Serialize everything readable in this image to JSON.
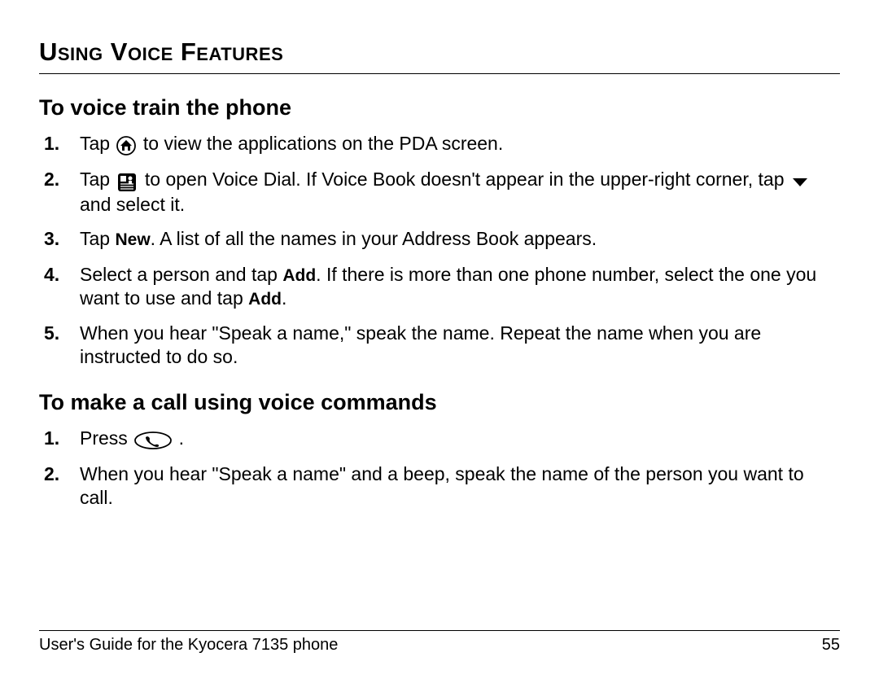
{
  "page_title": "Using Voice Features",
  "sections": [
    {
      "heading": "To voice train the phone",
      "steps": [
        {
          "parts": [
            {
              "type": "text",
              "value": "Tap "
            },
            {
              "type": "icon",
              "name": "home-icon"
            },
            {
              "type": "text",
              "value": " to view the applications on the PDA screen."
            }
          ]
        },
        {
          "parts": [
            {
              "type": "text",
              "value": "Tap "
            },
            {
              "type": "icon",
              "name": "voice-dial-icon"
            },
            {
              "type": "text",
              "value": " to open Voice Dial. If Voice Book doesn't appear in the upper-right corner, tap "
            },
            {
              "type": "icon",
              "name": "dropdown-triangle-icon"
            },
            {
              "type": "text",
              "value": " and select it."
            }
          ]
        },
        {
          "parts": [
            {
              "type": "text",
              "value": "Tap "
            },
            {
              "type": "bold",
              "value": "New"
            },
            {
              "type": "text",
              "value": ". A list of all the names in your Address Book appears."
            }
          ]
        },
        {
          "parts": [
            {
              "type": "text",
              "value": "Select a person and tap "
            },
            {
              "type": "bold",
              "value": "Add"
            },
            {
              "type": "text",
              "value": ". If there is more than one phone number, select the one you want to use and tap "
            },
            {
              "type": "bold",
              "value": "Add"
            },
            {
              "type": "text",
              "value": "."
            }
          ]
        },
        {
          "parts": [
            {
              "type": "text",
              "value": "When you hear \"Speak a name,\" speak the name. Repeat the name when you are instructed to do so."
            }
          ]
        }
      ]
    },
    {
      "heading": "To make a call using voice commands",
      "steps": [
        {
          "parts": [
            {
              "type": "text",
              "value": "Press "
            },
            {
              "type": "icon",
              "name": "call-button-icon"
            },
            {
              "type": "text",
              "value": "."
            }
          ]
        },
        {
          "parts": [
            {
              "type": "text",
              "value": "When you hear \"Speak a name\" and a beep, speak the name of the person you want to call."
            }
          ]
        }
      ]
    }
  ],
  "footer": {
    "left": "User's Guide for the Kyocera 7135 phone",
    "right": "55"
  },
  "icons": {
    "home": "house",
    "voice_dial": "microphone-card",
    "dropdown": "triangle-down",
    "call": "phone-oval"
  }
}
